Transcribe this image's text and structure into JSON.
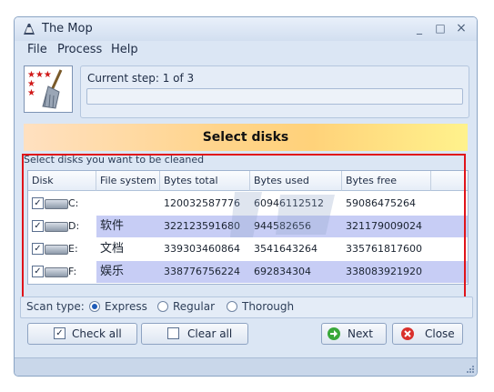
{
  "window": {
    "title": "The Mop",
    "minimize": "_",
    "maximize": "□",
    "close": "×"
  },
  "menu": [
    "File",
    "Process",
    "Help"
  ],
  "step": {
    "label": "Current step: 1 of 3",
    "progress_fraction": 0.0
  },
  "banner": "Select disks",
  "hint": "Select disks you want to be cleaned",
  "columns": [
    "Disk",
    "File system",
    "Bytes total",
    "Bytes used",
    "Bytes free"
  ],
  "disks": [
    {
      "checked": true,
      "letter": "C:",
      "fs": "",
      "total": "120032587776",
      "used": "60946112512",
      "free": "59086475264",
      "shaded": false
    },
    {
      "checked": true,
      "letter": "D:",
      "fs": "软件",
      "total": "322123591680",
      "used": "944582656",
      "free": "321179009024",
      "shaded": true
    },
    {
      "checked": true,
      "letter": "E:",
      "fs": "文档",
      "total": "339303460864",
      "used": "3541643264",
      "free": "335761817600",
      "shaded": false
    },
    {
      "checked": true,
      "letter": "F:",
      "fs": "娱乐",
      "total": "338776756224",
      "used": "692834304",
      "free": "338083921920",
      "shaded": true
    }
  ],
  "scan": {
    "label": "Scan type:",
    "options": [
      "Express",
      "Regular",
      "Thorough"
    ],
    "selected": "Express"
  },
  "buttons": {
    "check_all": "Check all",
    "clear_all": "Clear all",
    "next": "Next",
    "close": "Close"
  },
  "colors": {
    "accent_red": "#e0141a",
    "row_shade": "#c7cdf5",
    "banner_yellow": "#ffd27a"
  }
}
